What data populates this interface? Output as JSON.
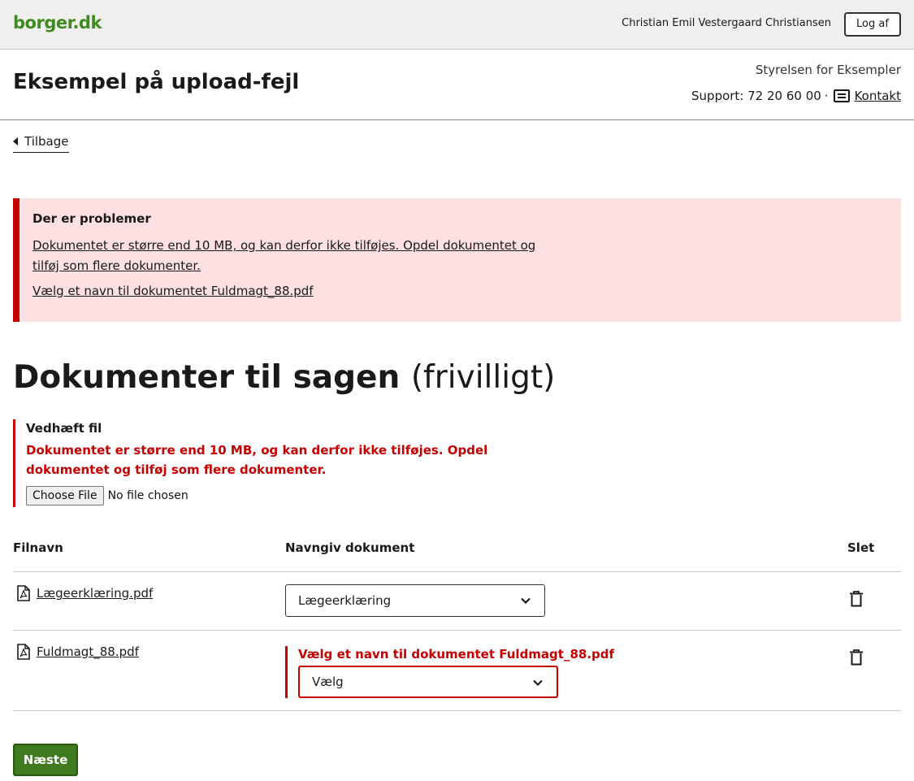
{
  "topbar": {
    "logo": "borger.dk",
    "user_name": "Christian Emil Vestergaard Christiansen",
    "logout_label": "Log af"
  },
  "header": {
    "title": "Eksempel på upload-fejl",
    "authority": "Styrelsen for Eksempler",
    "support_prefix": "Support: 72 20 60 00",
    "support_separator": "·",
    "contact_label": "Kontakt"
  },
  "back_label": "Tilbage",
  "error_summary": {
    "heading": "Der er problemer",
    "errors": [
      "Dokumentet er større end 10 MB, og kan derfor ikke tilføjes. Opdel dokumentet og tilføj som flere dokumenter.",
      "Vælg et navn til dokumentet Fuldmagt_88.pdf"
    ]
  },
  "section": {
    "title_strong": "Dokumenter til sagen",
    "title_light": "(frivilligt)"
  },
  "upload": {
    "label": "Vedhæft fil",
    "error": "Dokumentet er større end 10 MB, og kan derfor ikke tilføjes. Opdel dokumentet og tilføj som flere dokumenter.",
    "choose_label": "Choose File",
    "no_file_label": "No file chosen"
  },
  "table": {
    "headers": [
      "Filnavn",
      "Navngiv dokument",
      "Slet"
    ],
    "rows": [
      {
        "file": "Lægeerklæring.pdf",
        "selected": "Lægeerklæring",
        "error": ""
      },
      {
        "file": "Fuldmagt_88.pdf",
        "selected": "Vælg",
        "error": "Vælg et navn til dokumentet Fuldmagt_88.pdf"
      }
    ]
  },
  "next_label": "Næste",
  "colors": {
    "brand": "#3f8a21",
    "error": "#c40000",
    "error_bg": "#fde0e2",
    "primary_button": "#3f7a1e"
  }
}
